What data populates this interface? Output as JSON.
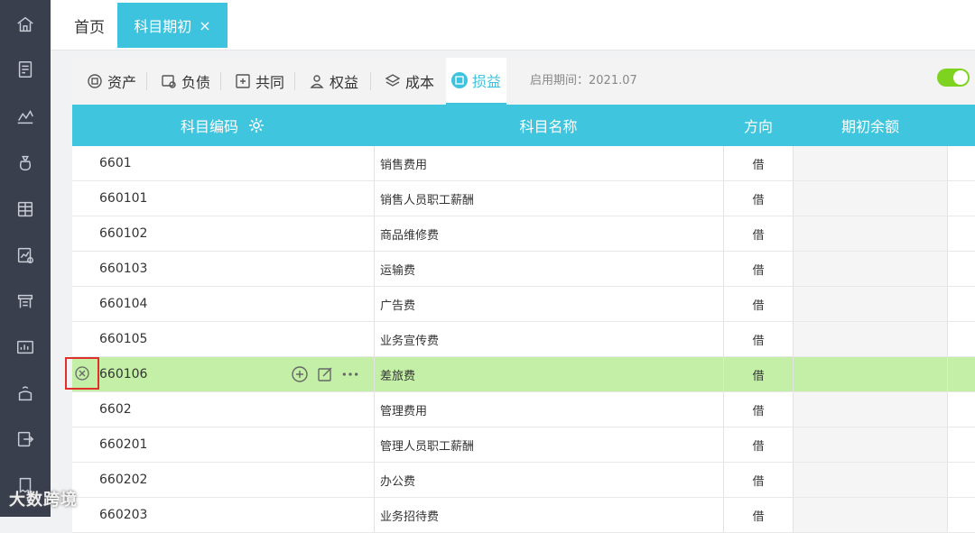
{
  "sidebar": {
    "icons": [
      "home-icon",
      "voucher-icon",
      "line-chart-icon",
      "money-bag-icon",
      "ledger-icon",
      "report-icon",
      "cashier-icon",
      "asset-chart-icon",
      "salary-icon",
      "export-icon",
      "invoice-icon"
    ]
  },
  "topbar": {
    "home_tab": "首页",
    "active_tab": "科目期初",
    "close_glyph": "×"
  },
  "categories": {
    "items": [
      {
        "label": "资产",
        "icon": "asset-icon"
      },
      {
        "label": "负债",
        "icon": "liability-icon"
      },
      {
        "label": "共同",
        "icon": "common-icon"
      },
      {
        "label": "权益",
        "icon": "equity-icon"
      },
      {
        "label": "成本",
        "icon": "cost-icon"
      },
      {
        "label": "损益",
        "icon": "profit-loss-icon",
        "active": true
      }
    ],
    "period": "启用期间：2021.07",
    "toggle_on": true
  },
  "table": {
    "headers": {
      "code": "科目编码",
      "name": "科目名称",
      "direction": "方向",
      "balance": "期初余额"
    },
    "rows": [
      {
        "code": "6601",
        "name": "销售费用",
        "direction": "借"
      },
      {
        "code": "660101",
        "name": "销售人员职工薪酬",
        "direction": "借"
      },
      {
        "code": "660102",
        "name": "商品维修费",
        "direction": "借"
      },
      {
        "code": "660103",
        "name": "运输费",
        "direction": "借"
      },
      {
        "code": "660104",
        "name": "广告费",
        "direction": "借"
      },
      {
        "code": "660105",
        "name": "业务宣传费",
        "direction": "借"
      },
      {
        "code": "660106",
        "name": "差旅费",
        "direction": "借",
        "highlighted": true
      },
      {
        "code": "6602",
        "name": "管理费用",
        "direction": "借"
      },
      {
        "code": "660201",
        "name": "管理人员职工薪酬",
        "direction": "借"
      },
      {
        "code": "660202",
        "name": "办公费",
        "direction": "借"
      },
      {
        "code": "660203",
        "name": "业务招待费",
        "direction": "借"
      }
    ]
  },
  "watermark": "大数跨境",
  "colors": {
    "accent": "#3ec3de",
    "highlight": "#c3f0a6",
    "sidebar": "#3a3f4d",
    "delete_border": "#e0302c",
    "toggle": "#7ed321"
  }
}
